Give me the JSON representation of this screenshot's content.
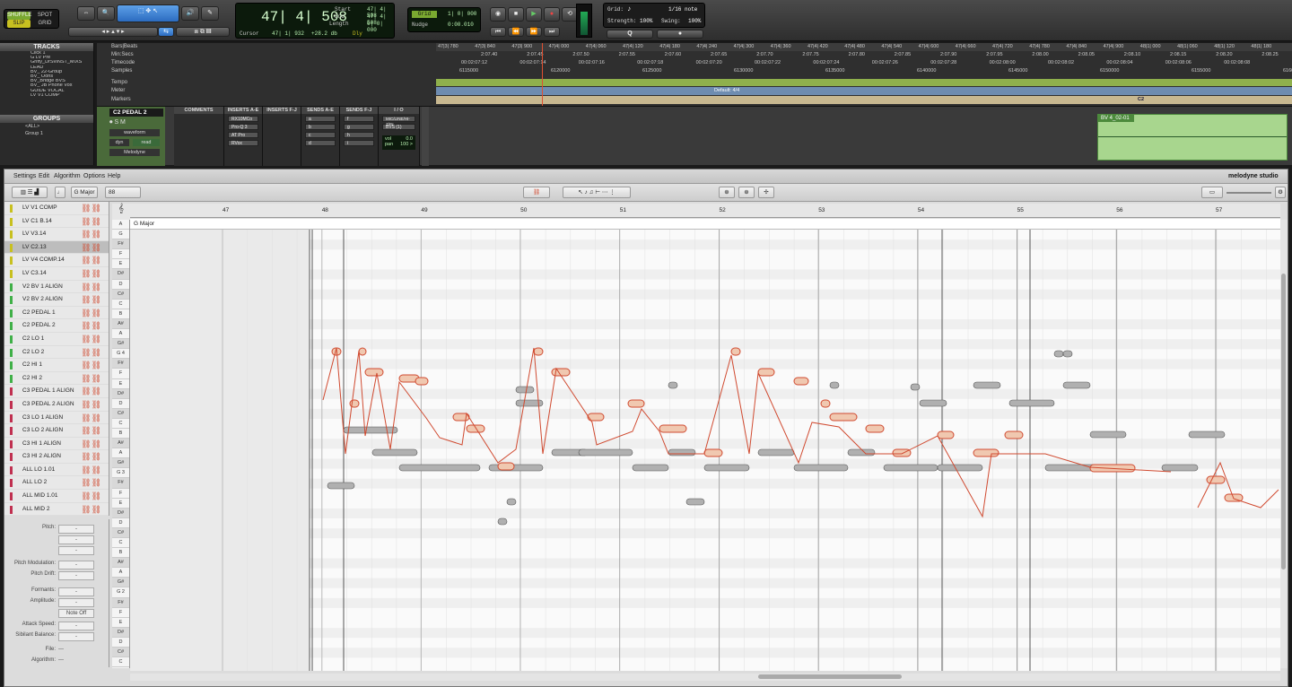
{
  "protools": {
    "modes": {
      "shuffle": "SHUFFLE",
      "spot": "SPOT",
      "slip": "SLIP",
      "grid": "GRID"
    },
    "counter": {
      "main": "47| 4| 508",
      "start_label": "Start",
      "end_label": "End",
      "length_label": "Length",
      "start": "47| 4| 508",
      "end": "47| 4| 508",
      "length": "0| 0| 000",
      "cursor_label": "Cursor",
      "cursor": "47| 1| 932",
      "db": "+28.2 db",
      "dly": "Dly"
    },
    "grid": {
      "grid_label": "Grid",
      "grid_value": "1| 0| 000",
      "nudge_label": "Nudge",
      "nudge_value": "0:00.010"
    },
    "quantize": {
      "grid_label": "Grid:",
      "grid_value": "1/16 note",
      "strength_label": "Strength:",
      "strength": "100%",
      "swing_label": "Swing:",
      "swing": "100%",
      "q_button": "Q"
    },
    "tracks_header": "TRACKS",
    "tracks": [
      "Click 1",
      "G LV Pre",
      "Griffy_DrSvINST_MIXS",
      "LEAD",
      "BV_ 22-Group",
      "BV_ Oohs",
      "BV_Bridge BVS",
      "BV_ JB Phone Vox",
      "GUIDE VOCAL",
      "LV V1 COMP"
    ],
    "groups_header": "GROUPS",
    "groups": [
      "<ALL>",
      "Group 1"
    ],
    "ruler_labels": [
      "Bars|Beats",
      "Min:Secs",
      "Timecode",
      "Samples",
      "Tempo",
      "Meter",
      "Markers"
    ],
    "bars_beats": [
      "47|3| 780",
      "47|3| 840",
      "47|3| 900",
      "47|4| 000",
      "47|4| 060",
      "47|4| 120",
      "47|4| 180",
      "47|4| 240",
      "47|4| 300",
      "47|4| 360",
      "47|4| 420",
      "47|4| 480",
      "47|4| 540",
      "47|4| 600",
      "47|4| 660",
      "47|4| 720",
      "47|4| 780",
      "47|4| 840",
      "47|4| 900",
      "48|1| 000",
      "48|1| 060",
      "48|1| 120",
      "48|1| 180"
    ],
    "min_secs": [
      "2:07.40",
      "2:07.45",
      "2:07.50",
      "2:07.55",
      "2:07.60",
      "2:07.65",
      "2:07.70",
      "2:07.75",
      "2:07.80",
      "2:07.85",
      "2:07.90",
      "2:07.95",
      "2:08.00",
      "2:08.05",
      "2:08.10",
      "2:08.15",
      "2:08.20",
      "2:08.25",
      "2:08.30"
    ],
    "timecode": [
      "00:02:07:12",
      "00:02:07:14",
      "00:02:07:16",
      "00:02:07:18",
      "00:02:07:20",
      "00:02:07:22",
      "00:02:07:24",
      "00:02:07:26",
      "00:02:07:28",
      "00:02:08:00",
      "00:02:08:02",
      "00:02:08:04",
      "00:02:08:06",
      "00:02:08:08"
    ],
    "samples": [
      "6115000",
      "6120000",
      "6125000",
      "6130000",
      "6135000",
      "6140000",
      "6145000",
      "6150000",
      "6155000",
      "6160"
    ],
    "meter": "Default: 4/4",
    "marker": "C2",
    "track_name": "C2 PEDAL 2",
    "waveform": "waveform",
    "dyn": "dyn",
    "read": "read",
    "plugin": "Melodyne",
    "mix_headers": [
      "COMMENTS",
      "INSERTS A-E",
      "INSERTS F-J",
      "SENDS A-E",
      "SENDS F-J",
      "I / O"
    ],
    "inserts": [
      "RX10MCo",
      "Pro-Q 3",
      "AT Pro",
      "RVox"
    ],
    "sends_ae": [
      "a",
      "b",
      "c",
      "d"
    ],
    "sends_fj": [
      "f",
      "g",
      "h",
      "i"
    ],
    "io": {
      "input": "MIC/LINE/HI-Z/IN",
      "output": "BVS (1)",
      "vol_label": "vol",
      "vol": "0.0",
      "pan_label": "pan",
      "pan": "100 >"
    },
    "clip": "BV 4_02-01"
  },
  "melodyne": {
    "menu": [
      "Settings",
      "Edit",
      "Algorithm",
      "Options",
      "Help"
    ],
    "logo": "melodyne studio",
    "scale": "G Major",
    "tempo": "88",
    "key_strip": "G Major",
    "bars": [
      "47",
      "48",
      "49",
      "50",
      "51",
      "52",
      "53",
      "54",
      "55",
      "56",
      "57"
    ],
    "tracks": [
      {
        "name": "LV V1 COMP",
        "color": "#c8c020"
      },
      {
        "name": "LV C1 B.14",
        "color": "#c8c020"
      },
      {
        "name": "LV V3.14",
        "color": "#c8c020"
      },
      {
        "name": "LV C2.13",
        "color": "#c8c020"
      },
      {
        "name": "LV V4 COMP.14",
        "color": "#c8c020"
      },
      {
        "name": "LV C3.14",
        "color": "#c8c020"
      },
      {
        "name": "V2 BV 1 ALIGN",
        "color": "#40b048"
      },
      {
        "name": "V2 BV 2 ALIGN",
        "color": "#40b048"
      },
      {
        "name": "C2 PEDAL 1",
        "color": "#40b048"
      },
      {
        "name": "C2 PEDAL 2",
        "color": "#40b048"
      },
      {
        "name": "C2 LO 1",
        "color": "#40b048"
      },
      {
        "name": "C2 LO 2",
        "color": "#40b048"
      },
      {
        "name": "C2 HI 1",
        "color": "#40b048"
      },
      {
        "name": "C2 HI 2",
        "color": "#40b048"
      },
      {
        "name": "C3 PEDAL 1 ALIGN",
        "color": "#c03050"
      },
      {
        "name": "C3 PEDAL 2 ALIGN",
        "color": "#c03050"
      },
      {
        "name": "C3 LO 1 ALIGN",
        "color": "#c03050"
      },
      {
        "name": "C3 LO 2 ALIGN",
        "color": "#c03050"
      },
      {
        "name": "C3 HI 1 ALIGN",
        "color": "#c03050"
      },
      {
        "name": "C3 HI 2 ALIGN",
        "color": "#c03050"
      },
      {
        "name": "ALL LO 1.01",
        "color": "#c03050"
      },
      {
        "name": "ALL LO 2",
        "color": "#c03050"
      },
      {
        "name": "ALL MID 1.01",
        "color": "#c03050"
      },
      {
        "name": "ALL MID 2",
        "color": "#c03050"
      }
    ],
    "selected_track": "LV C2.13",
    "params": {
      "pitch": "Pitch:",
      "pitch_mod": "Pitch Modulation:",
      "pitch_drift": "Pitch Drift:",
      "formants": "Formants:",
      "amplitude": "Amplitude:",
      "note_off": "Note Off",
      "attack": "Attack Speed:",
      "sibilant": "Sibilant Balance:",
      "file": "File:",
      "file_val": "---",
      "algorithm": "Algorithm:",
      "algorithm_val": "---",
      "dash": "-"
    },
    "keys": [
      "A",
      "G",
      "F#",
      "F",
      "E",
      "D#",
      "D",
      "C#",
      "C",
      "B",
      "A#",
      "A",
      "G#",
      "G 4",
      "F#",
      "F",
      "E",
      "D#",
      "D",
      "C#",
      "C",
      "B",
      "A#",
      "A",
      "G#",
      "G 3",
      "F#",
      "F",
      "E",
      "D#",
      "D",
      "C#",
      "C",
      "B",
      "A#",
      "A",
      "G#",
      "G 2",
      "F#",
      "F",
      "E",
      "D#",
      "D",
      "C#",
      "C"
    ],
    "colors": {
      "accent": "#d04a30",
      "active_note": "#e8a080",
      "inactive_note": "#9a9a9a"
    }
  }
}
